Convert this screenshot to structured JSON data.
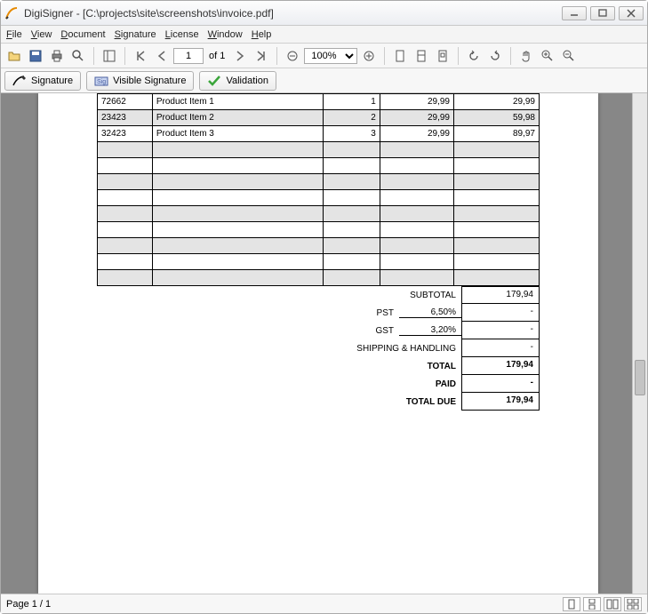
{
  "window": {
    "title": "DigiSigner - [C:\\projects\\site\\screenshots\\invoice.pdf]"
  },
  "menu": {
    "file": "File",
    "view": "View",
    "document": "Document",
    "signature": "Signature",
    "license": "License",
    "window": "Window",
    "help": "Help"
  },
  "toolbar": {
    "page_value": "1",
    "of_label": "of 1",
    "zoom_value": "100%",
    "signature": "Signature",
    "visible_signature": "Visible Signature",
    "validation": "Validation"
  },
  "invoice": {
    "rows": [
      {
        "id": "72662",
        "name": "Product Item 1",
        "qty": "1",
        "price": "29,99",
        "total": "29,99"
      },
      {
        "id": "23423",
        "name": "Product Item 2",
        "qty": "2",
        "price": "29,99",
        "total": "59,98"
      },
      {
        "id": "32423",
        "name": "Product Item 3",
        "qty": "3",
        "price": "29,99",
        "total": "89,97"
      }
    ],
    "summary": {
      "subtotal_label": "SUBTOTAL",
      "subtotal_value": "179,94",
      "pst_label": "PST",
      "pst_pct": "6,50%",
      "pst_value": "-",
      "gst_label": "GST",
      "gst_pct": "3,20%",
      "gst_value": "-",
      "ship_label": "SHIPPING & HANDLING",
      "ship_value": "-",
      "total_label": "TOTAL",
      "total_value": "179,94",
      "paid_label": "PAID",
      "paid_value": "-",
      "due_label": "TOTAL DUE",
      "due_value": "179,94"
    }
  },
  "status": {
    "page": "Page 1 / 1"
  }
}
